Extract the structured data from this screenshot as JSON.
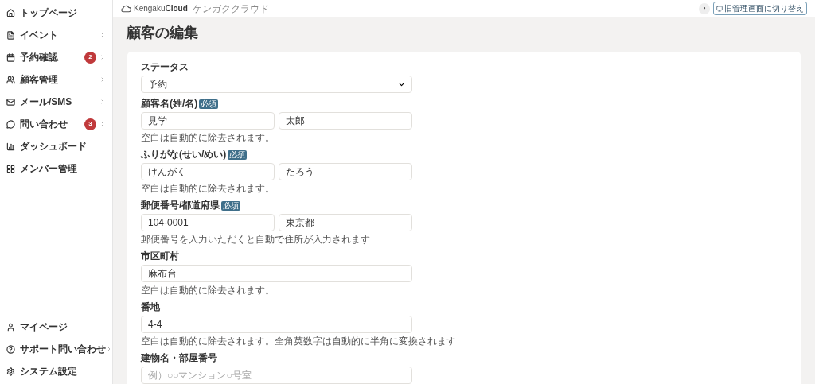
{
  "sidebar": {
    "items": [
      {
        "label": "トップページ",
        "submenu": false
      },
      {
        "label": "イベント",
        "submenu": true
      },
      {
        "label": "予約確認",
        "submenu": true,
        "badge": "2"
      },
      {
        "label": "顧客管理",
        "submenu": true
      },
      {
        "label": "メール/SMS",
        "submenu": true
      },
      {
        "label": "問い合わせ",
        "submenu": true,
        "badge": "3"
      },
      {
        "label": "ダッシュボード",
        "submenu": false
      },
      {
        "label": "メンバー管理",
        "submenu": false
      }
    ],
    "bottom_items": [
      {
        "label": "マイページ",
        "submenu": false
      },
      {
        "label": "サポート問い合わせ",
        "submenu": true
      },
      {
        "label": "システム設定",
        "submenu": false
      }
    ]
  },
  "header": {
    "logo": {
      "prefix": "Kengaku",
      "bold": "Cloud",
      "tagline": "ケンガククラウド"
    },
    "collapse_button": "›",
    "switch_button": "旧管理画面に切り替え"
  },
  "page_title": "顧客の編集",
  "form": {
    "fields": [
      {
        "kind": "select",
        "label": "ステータス",
        "value": "予約"
      },
      {
        "kind": "pair",
        "label": "顧客名(姓/名)",
        "required": "必須",
        "values": [
          "見学",
          "太郎"
        ],
        "hint": "空白は自動的に除去されます。"
      },
      {
        "kind": "pair",
        "label": "ふりがな(せい/めい)",
        "required": "必須",
        "values": [
          "けんがく",
          "たろう"
        ],
        "hint": "空白は自動的に除去されます。"
      },
      {
        "kind": "pair",
        "label": "郵便番号/都道府県",
        "required": "必須",
        "values": [
          "104-0001",
          "東京都"
        ],
        "hint": "郵便番号を入力いただくと自動で住所が入力されます"
      },
      {
        "kind": "single",
        "label": "市区町村",
        "values": [
          "麻布台"
        ],
        "hint": "空白は自動的に除去されます。"
      },
      {
        "kind": "single",
        "label": "番地",
        "values": [
          "4-4"
        ],
        "hint": "空白は自動的に除去されます。全角英数字は自動的に半角に変換されます"
      },
      {
        "kind": "single",
        "label": "建物名・部屋番号",
        "placeholder": "例）○○マンション○号室"
      }
    ]
  }
}
